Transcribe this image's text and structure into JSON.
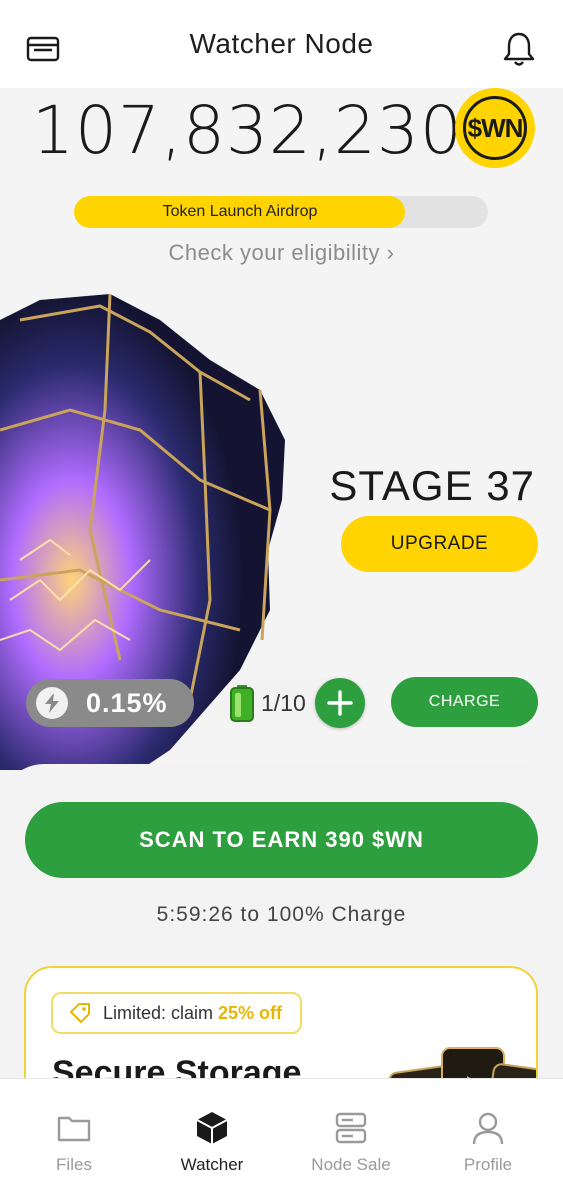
{
  "header": {
    "title": "Watcher Node",
    "left_icon": "wallet-icon",
    "right_icon": "bell-icon"
  },
  "balance": {
    "value": "107,832,230",
    "token_symbol": "$WN"
  },
  "airdrop": {
    "label": "Token Launch Airdrop",
    "progress_fraction": 0.8,
    "link_text": "Check your eligibility",
    "link_chevron": "›"
  },
  "node": {
    "stage_label": "STAGE 37",
    "upgrade_label": "UPGRADE"
  },
  "stats": {
    "boost_icon": "lightning-icon",
    "boost_value": "0.15%",
    "battery_icon": "battery-icon",
    "charges": "1/10",
    "add_icon": "plus-icon",
    "charge_label": "CHARGE"
  },
  "scan": {
    "button_label": "SCAN TO EARN 390 $WN",
    "timer_text": "5:59:26 to 100% Charge"
  },
  "promo": {
    "tag_icon": "price-tag-icon",
    "tag_prefix": "Limited: claim",
    "tag_discount": "25% off",
    "title": "Secure Storage"
  },
  "nav": {
    "items": [
      {
        "label": "Files",
        "icon": "folder-icon",
        "active": false
      },
      {
        "label": "Watcher",
        "icon": "cube-icon",
        "active": true
      },
      {
        "label": "Node Sale",
        "icon": "server-icon",
        "active": false
      },
      {
        "label": "Profile",
        "icon": "user-icon",
        "active": false
      }
    ]
  },
  "colors": {
    "accent_yellow": "#ffd400",
    "accent_green": "#2e9f3f",
    "background": "#f4f4f4",
    "text_dark": "#1c1c1c",
    "text_muted": "#8c8c8c"
  }
}
